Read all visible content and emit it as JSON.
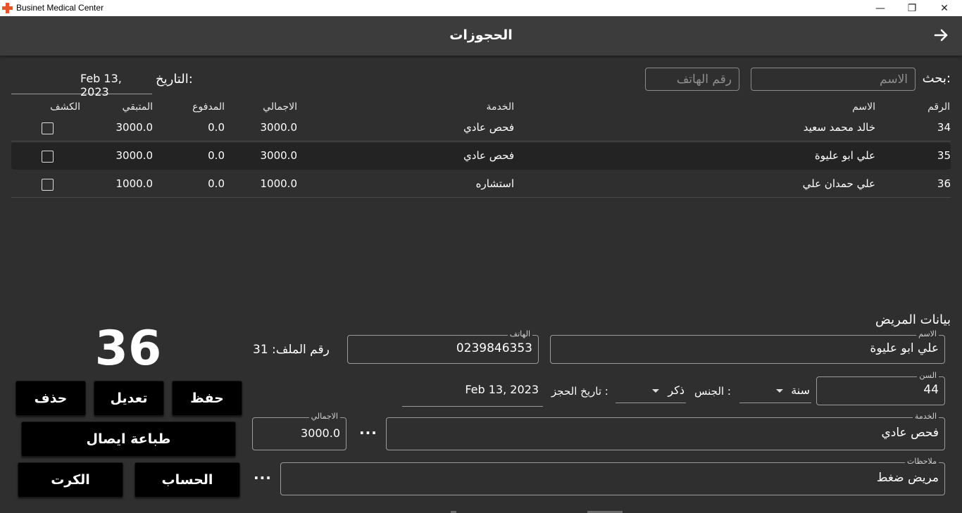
{
  "window": {
    "title": "Businet Medical Center",
    "minimize": "—",
    "maximize": "❐",
    "close": "✕"
  },
  "header": {
    "title": "الحجوزات",
    "back_icon": "arrow-right-icon"
  },
  "search": {
    "label": "بحث:",
    "name_placeholder": "الاسم",
    "phone_placeholder": "رقم الهاتف"
  },
  "date_filter": {
    "label": "التاريخ:",
    "value": "Feb 13, 2023"
  },
  "table": {
    "columns": {
      "number": "الرقم",
      "name": "الاسم",
      "service": "الخدمة",
      "total": "الاجمالي",
      "paid": "المدفوع",
      "remaining": "المتبقي",
      "checkup": "الكشف"
    },
    "rows": [
      {
        "number": "34",
        "name": "خالد محمد سعيد",
        "service": "فحص عادي",
        "total": "3000.0",
        "paid": "0.0",
        "remaining": "3000.0",
        "checked": false
      },
      {
        "number": "35",
        "name": "علي ابو عليوة",
        "service": "فحص عادي",
        "total": "3000.0",
        "paid": "0.0",
        "remaining": "3000.0",
        "checked": false
      },
      {
        "number": "36",
        "name": "علي حمدان علي",
        "service": "استشاره",
        "total": "1000.0",
        "paid": "0.0",
        "remaining": "1000.0",
        "checked": false
      }
    ]
  },
  "patient": {
    "section_title": "بيانات المريض",
    "reservation_number": "36",
    "file_number_label": "رقم الملف: 31",
    "name": {
      "label": "الاسم",
      "value": "علي ابو عليوة"
    },
    "phone": {
      "label": "الهاتف",
      "value": "0239846353"
    },
    "age": {
      "label": "السن",
      "value": "44",
      "unit": "سنة"
    },
    "gender": {
      "label": "الجنس :",
      "value": "ذكر"
    },
    "booking_date": {
      "label": "تاريخ الحجز :",
      "value": "Feb 13, 2023"
    },
    "service": {
      "label": "الخدمة",
      "value": "فحص عادي"
    },
    "total": {
      "label": "الاجمالي",
      "value": "3000.0"
    },
    "notes": {
      "label": "ملاحظات",
      "value": "مريض ضغط"
    },
    "more": "···"
  },
  "actions": {
    "save": "حفظ",
    "edit": "تعديل",
    "delete": "حذف",
    "print_receipt": "طباعة ايصال",
    "account": "الحساب",
    "card": "الكرت"
  }
}
